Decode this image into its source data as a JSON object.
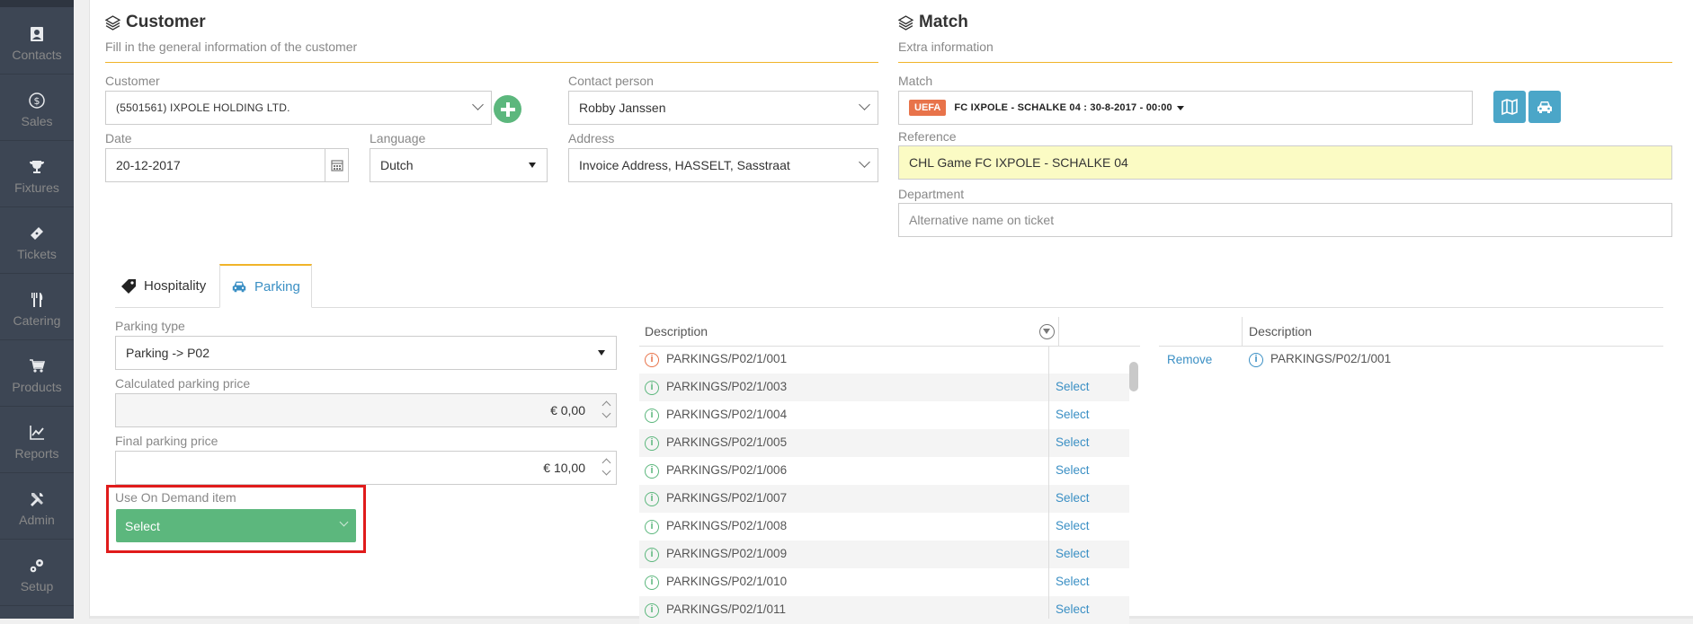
{
  "sidebar": {
    "items": [
      {
        "label": "Contacts",
        "icon": "contacts-icon"
      },
      {
        "label": "Sales",
        "icon": "dollar-icon"
      },
      {
        "label": "Fixtures",
        "icon": "trophy-icon"
      },
      {
        "label": "Tickets",
        "icon": "ticket-icon"
      },
      {
        "label": "Catering",
        "icon": "cutlery-icon"
      },
      {
        "label": "Products",
        "icon": "cart-icon"
      },
      {
        "label": "Reports",
        "icon": "chart-icon"
      },
      {
        "label": "Admin",
        "icon": "tools-icon"
      },
      {
        "label": "Setup",
        "icon": "cogs-icon"
      }
    ]
  },
  "customer_section": {
    "title": "Customer",
    "subtitle": "Fill in the general information of the customer",
    "customer_label": "Customer",
    "customer_value": "(5501561) IXPOLE HOLDING LTD.",
    "contact_label": "Contact person",
    "contact_value": "Robby Janssen",
    "date_label": "Date",
    "date_value": "20-12-2017",
    "language_label": "Language",
    "language_value": "Dutch",
    "address_label": "Address",
    "address_value": "Invoice Address, HASSELT, Sasstraat"
  },
  "match_section": {
    "title": "Match",
    "subtitle": "Extra information",
    "match_label": "Match",
    "match_badge": "UEFA",
    "match_value": "FC IXPOLE - SCHALKE 04 : 30-8-2017 - 00:00",
    "reference_label": "Reference",
    "reference_value": "CHL Game FC IXPOLE - SCHALKE 04",
    "department_label": "Department",
    "department_placeholder": "Alternative name on ticket"
  },
  "tabs": [
    {
      "label": "Hospitality",
      "active": false
    },
    {
      "label": "Parking",
      "active": true
    }
  ],
  "parking": {
    "type_label": "Parking type",
    "type_value": "Parking -> P02",
    "calc_label": "Calculated parking price",
    "calc_value": "€ 0,00",
    "final_label": "Final parking price",
    "final_value": "€ 10,00",
    "ondemand_label": "Use On Demand item",
    "ondemand_value": "Select"
  },
  "available_grid": {
    "header": "Description",
    "rows": [
      {
        "desc": "PARKINGS/P02/1/001",
        "action": "",
        "status": "warn"
      },
      {
        "desc": "PARKINGS/P02/1/003",
        "action": "Select",
        "status": "ok"
      },
      {
        "desc": "PARKINGS/P02/1/004",
        "action": "Select",
        "status": "ok"
      },
      {
        "desc": "PARKINGS/P02/1/005",
        "action": "Select",
        "status": "ok"
      },
      {
        "desc": "PARKINGS/P02/1/006",
        "action": "Select",
        "status": "ok"
      },
      {
        "desc": "PARKINGS/P02/1/007",
        "action": "Select",
        "status": "ok"
      },
      {
        "desc": "PARKINGS/P02/1/008",
        "action": "Select",
        "status": "ok"
      },
      {
        "desc": "PARKINGS/P02/1/009",
        "action": "Select",
        "status": "ok"
      },
      {
        "desc": "PARKINGS/P02/1/010",
        "action": "Select",
        "status": "ok"
      },
      {
        "desc": "PARKINGS/P02/1/011",
        "action": "Select",
        "status": "ok"
      }
    ]
  },
  "selected_grid": {
    "header": "Description",
    "rows": [
      {
        "action": "Remove",
        "desc": "PARKINGS/P02/1/001"
      }
    ]
  },
  "colors": {
    "sidebar": "#3d4654",
    "accent": "#f0b429",
    "link": "#3a8fc4",
    "green": "#5cb77d",
    "reference_bg": "#fbfbc4",
    "badge": "#e8734a",
    "highlight_box": "#e01b1b"
  }
}
